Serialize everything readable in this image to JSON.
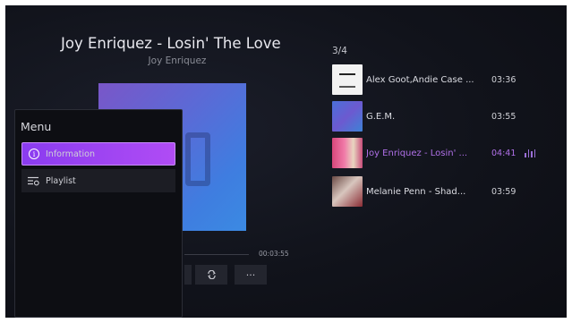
{
  "now_playing": {
    "title": "Joy Enriquez - Losin' The Love",
    "artist": "Joy Enriquez",
    "total_time": "00:03:55"
  },
  "controls": {
    "more_label": "···"
  },
  "menu": {
    "title": "Menu",
    "items": [
      {
        "label": "Information",
        "icon": "info-icon",
        "selected": true
      },
      {
        "label": "Playlist",
        "icon": "playlist-icon",
        "selected": false
      }
    ]
  },
  "queue": {
    "position": "3/4",
    "tracks": [
      {
        "name": "Alex Goot,Andie Case ...",
        "duration": "03:36",
        "playing": false
      },
      {
        "name": "G.E.M.",
        "duration": "03:55",
        "playing": false
      },
      {
        "name": "Joy Enriquez - Losin' ...",
        "duration": "04:41",
        "playing": true
      },
      {
        "name": "Melanie Penn - Shad...",
        "duration": "03:59",
        "playing": false
      }
    ]
  },
  "colors": {
    "accent": "#a040f2",
    "playing_text": "#b070e8",
    "background": "#11131b"
  }
}
